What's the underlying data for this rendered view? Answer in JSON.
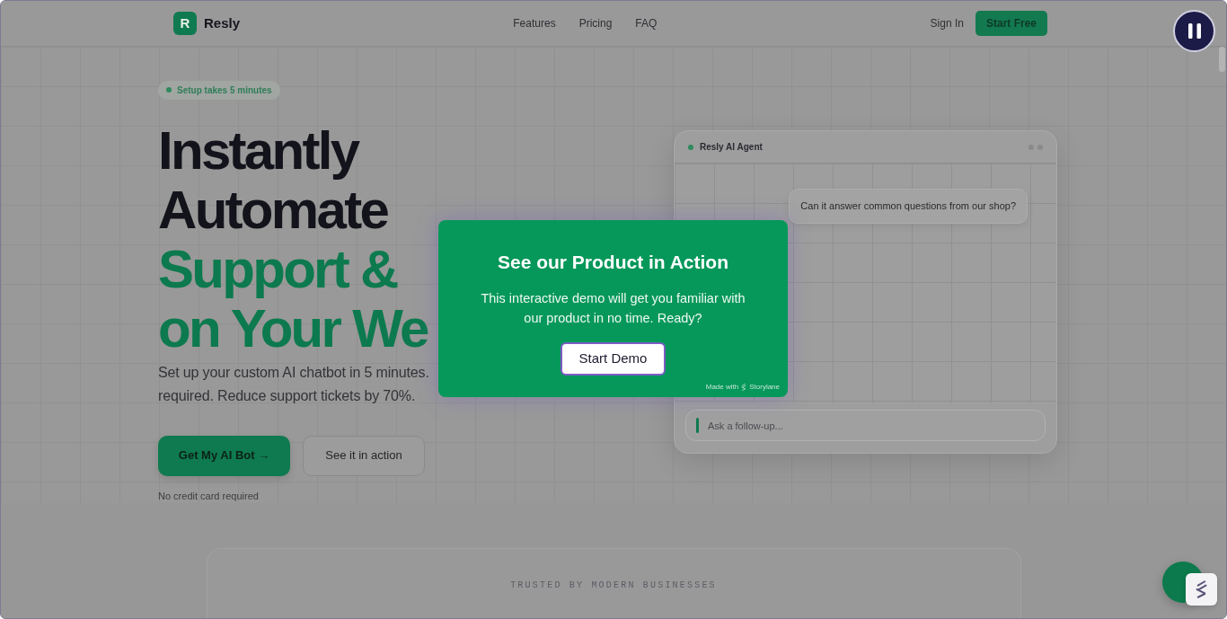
{
  "nav": {
    "logo_letter": "R",
    "brand": "Resly",
    "links": [
      "Features",
      "Pricing",
      "FAQ"
    ],
    "sign_in": "Sign In",
    "cta": "Start Free"
  },
  "hero": {
    "badge": "Setup takes 5 minutes",
    "headline": [
      {
        "text": "Instantly",
        "kind": "plain"
      },
      {
        "text": "Automate",
        "kind": "plain"
      },
      {
        "text": "Support &",
        "kind": "accent"
      },
      {
        "text": "on Your We",
        "kind": "accent"
      }
    ],
    "subtitle_lines": [
      "Set up your custom AI chatbot in 5 minutes.",
      "required. Reduce support tickets by 70%."
    ],
    "buttons": [
      {
        "label": "Get My AI Bot →",
        "kind": "primary"
      },
      {
        "label": "See it in action",
        "kind": "secondary"
      }
    ],
    "note": "No credit card required"
  },
  "chat_preview": {
    "title": "Resly AI Agent",
    "messages": [
      {
        "text": "Can it answer common questions from our shop?"
      }
    ],
    "input": {
      "placeholder": "Ask a follow-up..."
    }
  },
  "trusted": {
    "heading": "TRUSTED BY MODERN BUSINESSES"
  },
  "demo_modal": {
    "title": "See our Product in Action",
    "body": "This interactive demo will get you familiar with our product in no time. Ready?",
    "button": "Start Demo",
    "credit": "Made with",
    "brand": "Storylane"
  }
}
